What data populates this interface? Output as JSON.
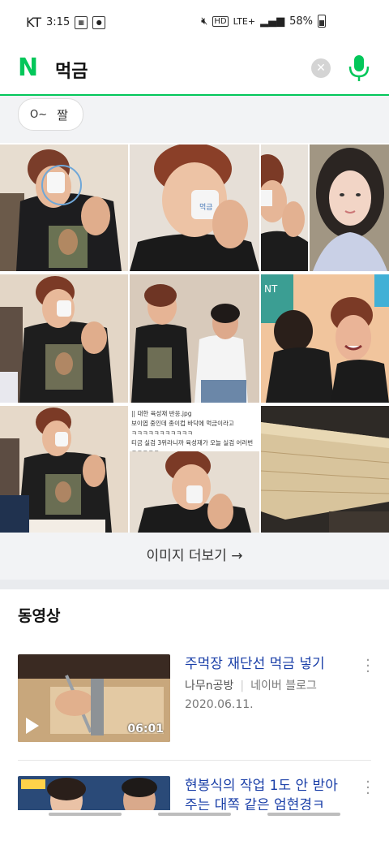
{
  "status": {
    "carrier": "KT",
    "time": "3:15",
    "network": "LTE+",
    "hd": "HD",
    "battery": "58%"
  },
  "search": {
    "logo": "N",
    "query": "먹금",
    "clear_icon": "close-icon",
    "mic_icon": "microphone-icon",
    "accent": "#03c75a"
  },
  "chips": [
    {
      "icon": "O~",
      "label": "짤"
    }
  ],
  "images": {
    "caption_lines": [
      "|| 대한 육성재 반응.jpg",
      "보이엽 중인데 종이컵 바닥에 먹금이라고",
      "ㅋㅋㅋㅋㅋㅋㅋㅋㅋㅋㅋ",
      "티금 실검 3위라니까 육성재가 오늘 실검 어러번",
      "ㅋㅋㅋㅋㅋ"
    ],
    "more_label": "이미지 더보기 →"
  },
  "videos_section": {
    "title": "동영상",
    "items": [
      {
        "title": "주먹장 재단선 먹금 넣기",
        "source": "나무n공방",
        "platform": "네이버 블로그",
        "date": "2020.06.11.",
        "duration": "06:01"
      },
      {
        "title": "현봉식의 작업 1도 안 받아 주는 대쪽 같은 엄현경ㅋ",
        "source": "",
        "platform": "",
        "date": "",
        "duration": ""
      }
    ]
  }
}
